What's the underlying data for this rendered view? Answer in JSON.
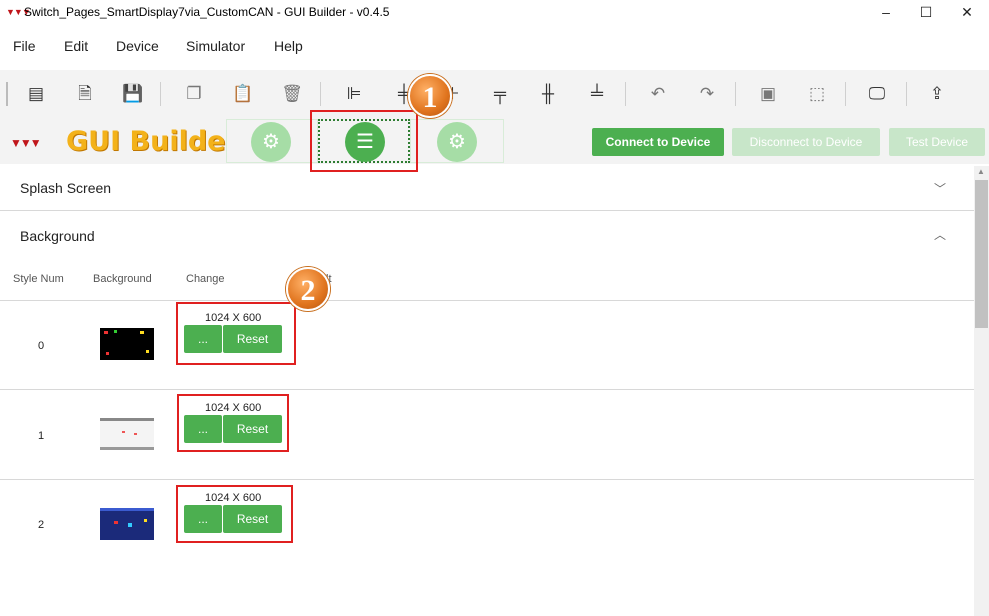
{
  "window": {
    "app_logo": "▼▼▼",
    "title": "Switch_Pages_SmartDisplay7via_CustomCAN - GUI Builder - v0.4.5",
    "minimize": "–",
    "maximize": "☐",
    "close": "✕"
  },
  "menu": {
    "file": "File",
    "edit": "Edit",
    "device": "Device",
    "simulator": "Simulator",
    "help": "Help"
  },
  "brand": {
    "name": "GUI Builder",
    "mark": "▼▼▼"
  },
  "nav": {
    "tab1_icon": "⚙",
    "tab2_icon": "☰",
    "tab3_icon": "⚙"
  },
  "actions": {
    "connect": "Connect to Device",
    "disconnect": "Disconnect to Device",
    "test": "Test Device"
  },
  "sections": {
    "splash": "Splash Screen",
    "background": "Background"
  },
  "table": {
    "headers": {
      "style_num": "Style Num",
      "background": "Background",
      "change": "Change",
      "extra": "lt"
    },
    "rows": [
      {
        "num": "0",
        "resolution": "1024 X 600",
        "browse": "...",
        "reset": "Reset"
      },
      {
        "num": "1",
        "resolution": "1024 X 600",
        "browse": "...",
        "reset": "Reset"
      },
      {
        "num": "2",
        "resolution": "1024 X 600",
        "browse": "...",
        "reset": "Reset"
      }
    ]
  },
  "callouts": {
    "one": "1",
    "two": "2"
  },
  "colors": {
    "accent_green": "#4caf50",
    "callout_red": "#e02020",
    "badge_orange": "#e0741e"
  },
  "icons": [
    "table-layout-icon",
    "new-file-icon",
    "save-icon",
    "copy-icon",
    "paste-icon",
    "delete-icon",
    "align-left-icon",
    "align-center-icon",
    "align-right-icon",
    "align-top-icon",
    "align-middle-icon",
    "align-bottom-icon",
    "undo-icon",
    "redo-icon",
    "group-icon",
    "ungroup-icon",
    "display-icon",
    "upload-icon"
  ]
}
